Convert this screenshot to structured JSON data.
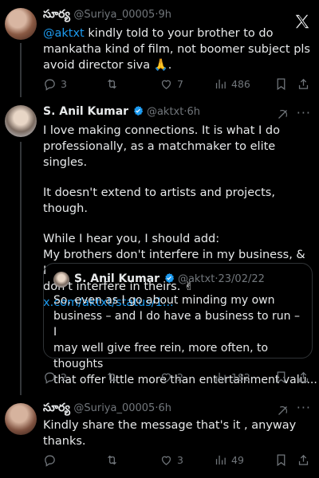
{
  "app": {
    "logo_icon": "x-logo-icon"
  },
  "tweets": [
    {
      "author_name": "సూర్య",
      "handle": "@Suriya_00005",
      "dot": "·",
      "time": "9h",
      "mention": "@aktxt",
      "text_after_mention": " kindly told to your brother to do mankatha kind of film,  not boomer subject pls avoid director siva ",
      "emoji": "🙏",
      "text_end": ".",
      "stats": {
        "replies": "3",
        "reposts": "",
        "likes": "7",
        "views": "486"
      }
    },
    {
      "author_name": "S. Anil Kumar",
      "handle": "@aktxt",
      "dot": "·",
      "time": "6h",
      "lines": [
        "I love making connections. It is what I do",
        "professionally, as a matchmaker to elite singles.",
        "It doesn't extend to artists and projects, though.",
        "While I hear you, I should add:",
        "My brothers don't interfere in my business, & I",
        "don't interfere in theirs. ✌"
      ],
      "link": "x.com/aktxt/status/1...",
      "quote": {
        "author_name": "S. Anil Kumar",
        "handle": "@aktxt",
        "dot": "·",
        "date": "23/02/22",
        "lines": [
          "So, even as I go about minding my own",
          "business – and I do have a business to run – I",
          "may well give free rein, more often, to thoughts",
          "that offer little more than entertainment valu..."
        ]
      },
      "stats": {
        "replies": "2",
        "reposts": "",
        "likes": "2",
        "views": "182"
      }
    },
    {
      "author_name": "సూర్య",
      "handle": "@Suriya_00005",
      "dot": "·",
      "time": "6h",
      "lines": [
        "Kindly share the message that's it , anyway",
        "thanks."
      ],
      "stats": {
        "replies": "",
        "reposts": "",
        "likes": "3",
        "views": "49"
      }
    }
  ],
  "colors": {
    "background": "#000000",
    "text": "#e7e9ea",
    "muted": "#71767b",
    "accent": "#1d9bf0",
    "border": "#2f3336"
  }
}
